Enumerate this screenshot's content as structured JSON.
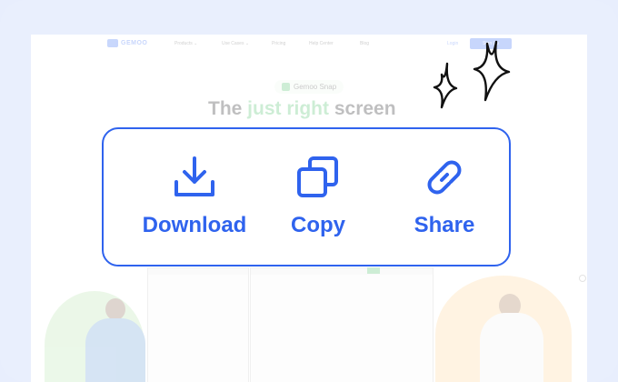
{
  "site": {
    "brand": "GEMOO",
    "nav": [
      "Products ⌄",
      "Use Cases ⌄",
      "Pricing",
      "Help Center",
      "Blog"
    ],
    "login": "Login",
    "cta": "Sign Up",
    "badge": "Gemoo Snap",
    "headline_pre": "The ",
    "headline_hl": "just right",
    "headline_post": " screen"
  },
  "actions": [
    {
      "label": "Download",
      "icon": "download-icon"
    },
    {
      "label": "Copy",
      "icon": "copy-icon"
    },
    {
      "label": "Share",
      "icon": "link-icon"
    }
  ],
  "colors": {
    "accent": "#2f63ee",
    "background": "#e8eefd",
    "green": "#4ec26a"
  }
}
